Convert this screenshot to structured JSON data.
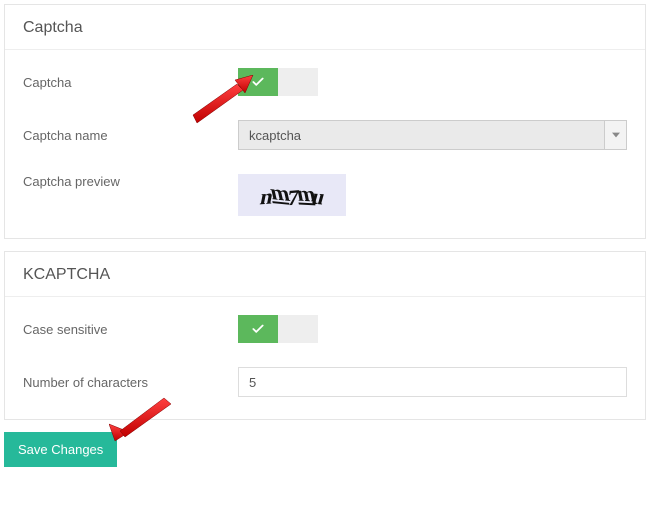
{
  "sections": {
    "captcha": {
      "title": "Captcha",
      "fields": {
        "enable_label": "Captcha",
        "name_label": "Captcha name",
        "name_value": "kcaptcha",
        "preview_label": "Captcha preview",
        "preview_text": "nm7mu"
      }
    },
    "kcaptcha": {
      "title": "KCAPTCHA",
      "fields": {
        "case_label": "Case sensitive",
        "numchars_label": "Number of characters",
        "numchars_value": "5"
      }
    }
  },
  "buttons": {
    "save": "Save Changes"
  },
  "colors": {
    "toggle_on": "#5cb85c",
    "save_bg": "#26b99a"
  }
}
